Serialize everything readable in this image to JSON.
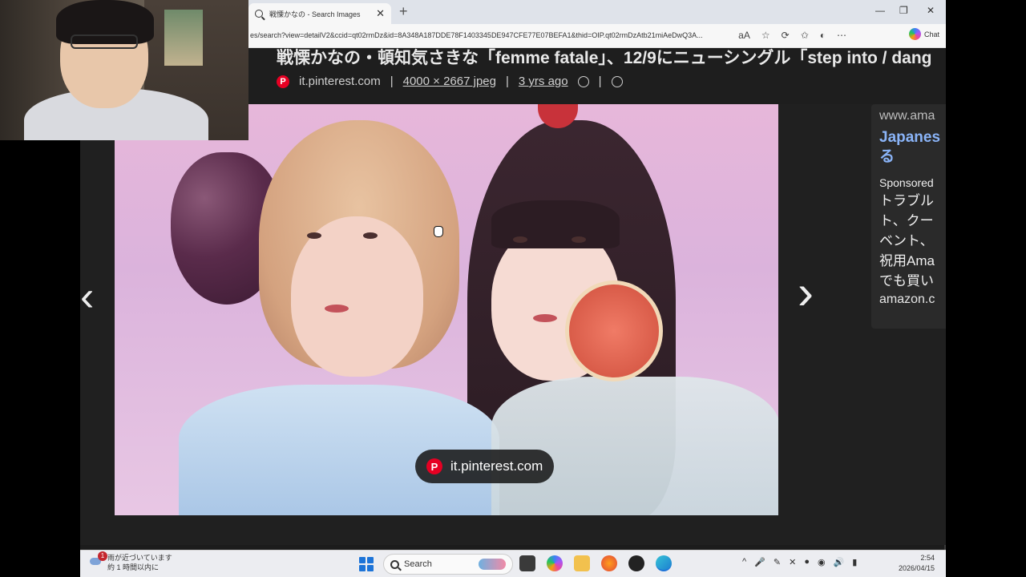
{
  "browser": {
    "tab_title": "戦慄かなの - Search Images",
    "tab_close": "✕",
    "new_tab": "+",
    "window_controls": {
      "minimize": "—",
      "maximize": "❐",
      "close": "✕"
    },
    "url": "es/search?view=detailV2&ccid=qt02rmDz&id=8A348A187DDE78F1403345DE947CFE77E07BEFA1&thid=OIP.qt02rmDzAtb21miAeDwQ3A...",
    "address_icons": [
      "aA",
      "☆",
      "⟳",
      "✩",
      "◐",
      "⋯"
    ],
    "chat_label": "Chat"
  },
  "result": {
    "headline": "戦慄かなの・頓知気さきな「femme fatale」、12/9にニューシングル「step into / dang",
    "source_domain": "it.pinterest.com",
    "separator": "|",
    "dimensions": "4000 × 2667 jpeg",
    "age": "3 yrs ago"
  },
  "image": {
    "watermark_text": "it.pinterest.com",
    "nav_prev": "‹",
    "nav_next": "›"
  },
  "ad": {
    "domain": "www.ama",
    "title_line1": "Japanes",
    "title_line2": "る",
    "sponsored": "Sponsored",
    "body_lines": [
      "トラブル",
      "ト、クー",
      "ベント、",
      "祝用Ama",
      "でも買い"
    ],
    "link": "amazon.c"
  },
  "taskbar": {
    "weather_badge": "1",
    "weather_line1": "雨が近づいています",
    "weather_line2": "約 1 時間以内に",
    "search_label": "Search",
    "tray_icons": [
      "^",
      "🎤",
      "✎",
      "✕",
      "●",
      "◉",
      "🔊",
      "▮"
    ],
    "time": "2:54",
    "date": "2026/04/15"
  },
  "colors": {
    "pinterest": "#e60023",
    "link_blue": "#8ab4f8",
    "windows_blue": "#1d74d8"
  }
}
